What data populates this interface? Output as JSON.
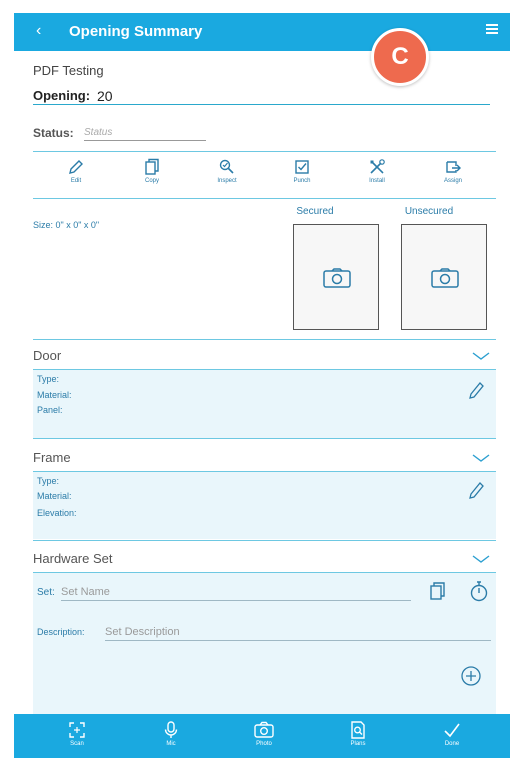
{
  "header": {
    "back_icon": "chevron-left-icon",
    "title": "Opening Summary",
    "menu_icon": "hamburger-menu-icon",
    "badge_letter": "C",
    "badge_color": "#ee6a4e",
    "bar_color": "#1aa9e0"
  },
  "project": {
    "name": "PDF Testing"
  },
  "opening": {
    "label": "Opening:",
    "value": "20"
  },
  "status": {
    "label": "Status:",
    "placeholder": "Status"
  },
  "toolbar": {
    "edit": "Edit",
    "copy": "Copy",
    "inspect": "Inspect",
    "punch": "Punch",
    "install": "Install",
    "assign": "Assign"
  },
  "size": {
    "text": "Size: 0\" x 0\" x 0\""
  },
  "photos": {
    "secured": "Secured",
    "unsecured": "Unsecured"
  },
  "door": {
    "title": "Door",
    "fields": [
      "Type:",
      "Material:",
      "Panel:"
    ]
  },
  "frame": {
    "title": "Frame",
    "fields": [
      "Type:",
      "Material:",
      "Elevation:"
    ]
  },
  "hardware": {
    "title": "Hardware Set",
    "set_label": "Set:",
    "set_placeholder": "Set Name",
    "description_label": "Description:",
    "description_placeholder": "Set Description"
  },
  "bottom_bar": {
    "scan": "Scan",
    "mic": "Mic",
    "photo": "Photo",
    "plans": "Plans",
    "done": "Done"
  }
}
